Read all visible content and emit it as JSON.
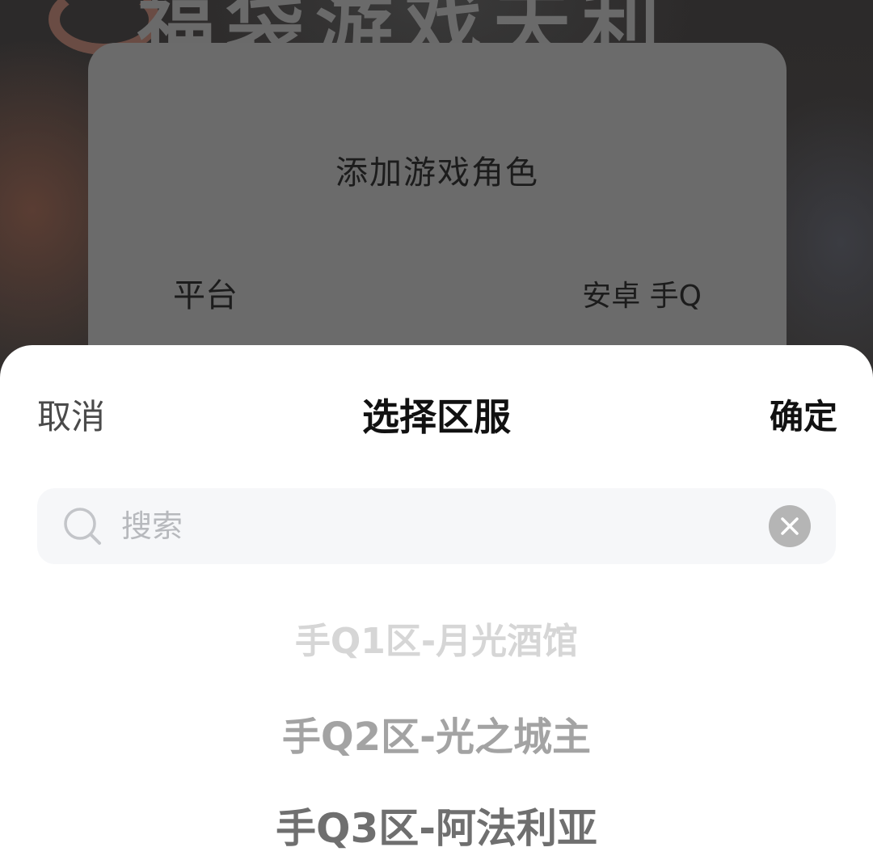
{
  "background": {
    "banner_text": "福袋游戏天利"
  },
  "dialog": {
    "title": "添加游戏角色",
    "platform_label": "平台",
    "platform_value": "安卓 手Q"
  },
  "sheet": {
    "cancel_label": "取消",
    "title": "选择区服",
    "confirm_label": "确定",
    "search": {
      "placeholder": "搜索",
      "value": "",
      "icon": "search-icon",
      "clear_icon": "close-circle-icon"
    },
    "servers": [
      "手Q1区-月光酒馆",
      "手Q2区-光之城主",
      "手Q3区-阿法利亚"
    ]
  },
  "colors": {
    "sheet_background": "#ffffff",
    "search_background": "#f6f7f9",
    "dim_overlay": "#6b6b6b"
  }
}
